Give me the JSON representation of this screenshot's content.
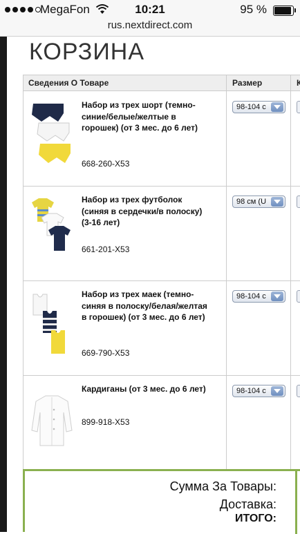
{
  "status_bar": {
    "carrier": "MegaFon",
    "time": "10:21",
    "battery": "95 %",
    "signal_bars_filled": 4,
    "signal_bars_total": 5,
    "battery_level_fraction": 0.95
  },
  "browser": {
    "url": "rus.nextdirect.com"
  },
  "page": {
    "title": "КОРЗИНА"
  },
  "table": {
    "headers": {
      "product": "Сведения О Товаре",
      "size": "Размер",
      "qty": "К"
    }
  },
  "items": [
    {
      "name": "Набор из трех шорт (темно-синие/белые/желтые в горошек) (от 3 мес. до 6 лет)",
      "code": "668-260-X53",
      "size": "98-104 с"
    },
    {
      "name": "Набор из трех футболок (синяя в сердечки/в полоску) (3-16 лет)",
      "code": "661-201-X53",
      "size": "98 см (U"
    },
    {
      "name": "Набор из трех маек (темно-синяя в полоску/белая/желтая в горошек) (от 3 мес. до 6 лет)",
      "code": "669-790-X53",
      "size": "98-104 с"
    },
    {
      "name": "Кардиганы (от 3 мес. до 6 лет)",
      "code": "899-918-X53",
      "size": "98-104 с"
    }
  ],
  "totals": {
    "subtotal_label": "Сумма За Товары:",
    "delivery_label": "Доставка:",
    "total_label": "ИТОГО:"
  },
  "colors": {
    "accent_green": "#8ab04f",
    "select_blue": "#6f8fc0"
  }
}
